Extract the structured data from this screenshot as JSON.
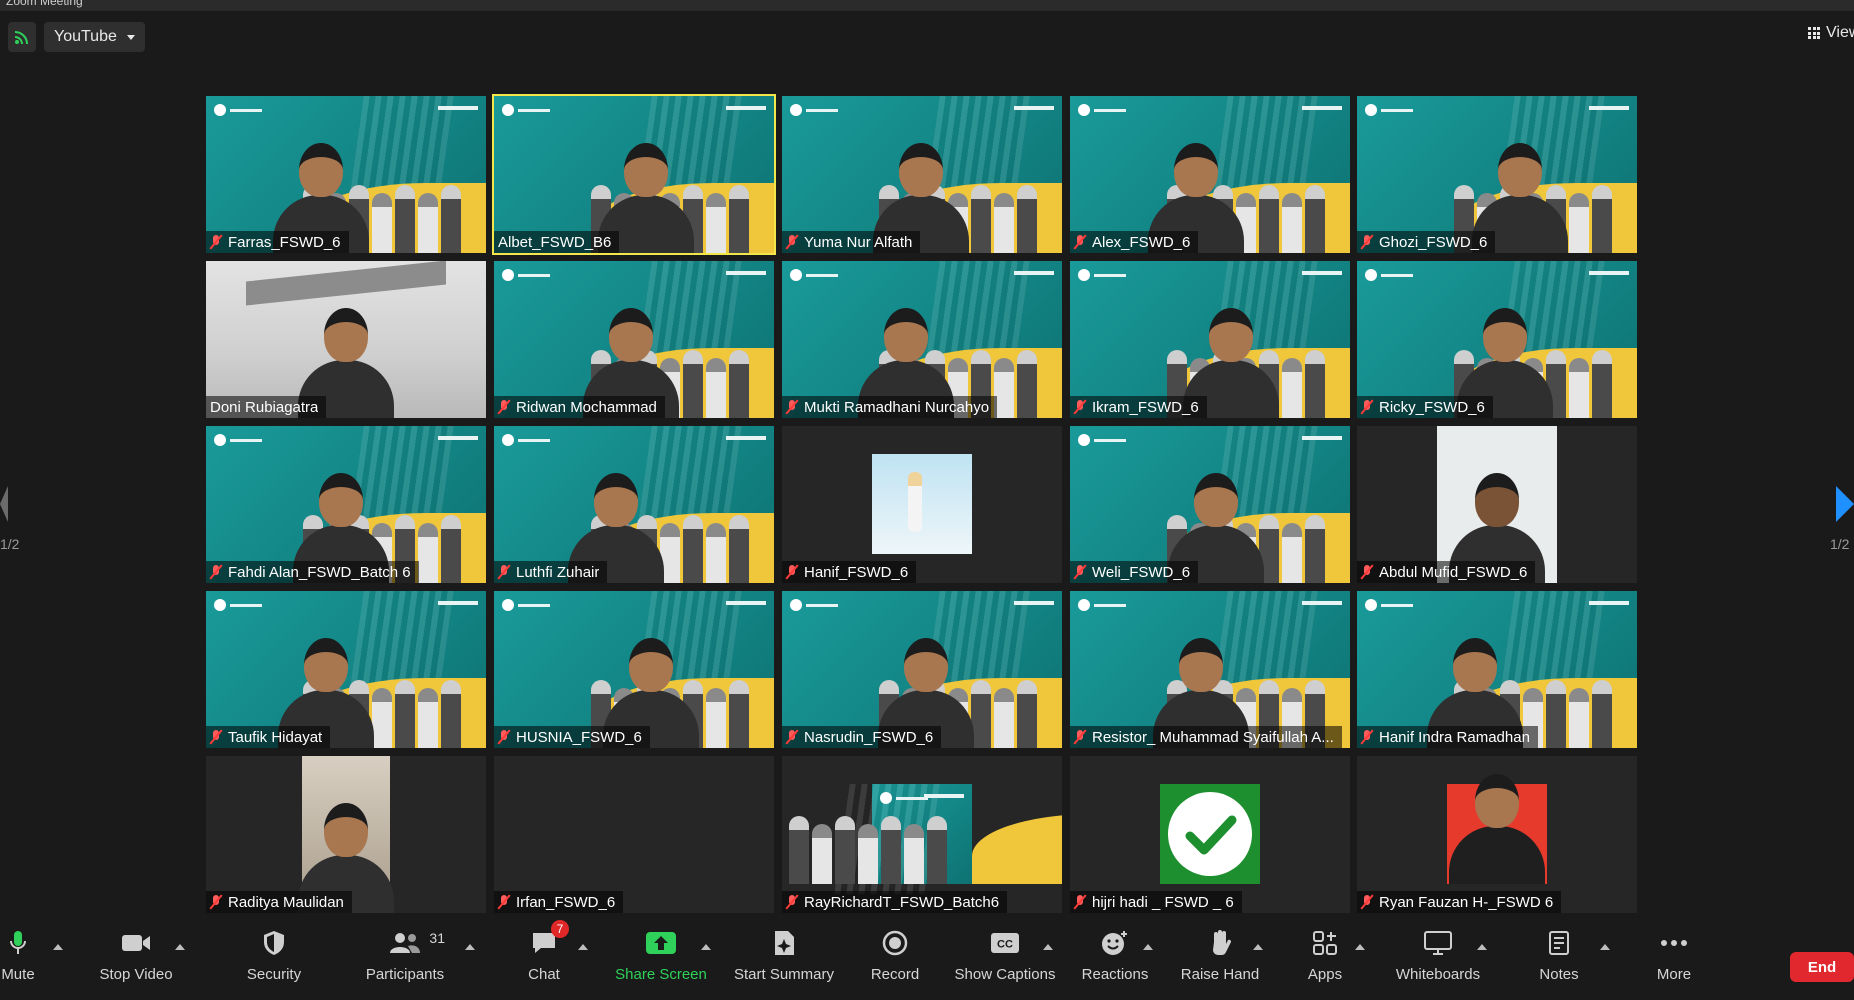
{
  "window": {
    "title": "Zoom Meeting"
  },
  "top_bar": {
    "source_select": "YouTube",
    "view_label": "View"
  },
  "pagination": {
    "left": "1/2",
    "right": "1/2"
  },
  "participants": [
    {
      "name": "Farras_FSWD_6",
      "muted": true
    },
    {
      "name": "Albet_FSWD_B6",
      "muted": false,
      "active_speaker": true
    },
    {
      "name": "Yuma Nur Alfath",
      "muted": true
    },
    {
      "name": "Alex_FSWD_6",
      "muted": true
    },
    {
      "name": "Ghozi_FSWD_6",
      "muted": true
    },
    {
      "name": "Doni Rubiagatra",
      "muted": false
    },
    {
      "name": "Ridwan Mochammad",
      "muted": true
    },
    {
      "name": "Mukti Ramadhani Nurcahyo",
      "muted": true
    },
    {
      "name": "Ikram_FSWD_6",
      "muted": true
    },
    {
      "name": "Ricky_FSWD_6",
      "muted": true
    },
    {
      "name": "Fahdi Alan_FSWD_Batch 6",
      "muted": true
    },
    {
      "name": "Luthfi Zuhair",
      "muted": true
    },
    {
      "name": "Hanif_FSWD_6",
      "muted": true
    },
    {
      "name": "Weli_FSWD_6",
      "muted": true
    },
    {
      "name": "Abdul Mufid_FSWD_6",
      "muted": true
    },
    {
      "name": "Taufik Hidayat",
      "muted": true
    },
    {
      "name": "HUSNIA_FSWD_6",
      "muted": true
    },
    {
      "name": "Nasrudin_FSWD_6",
      "muted": true
    },
    {
      "name": "Resistor_ Muhammad Syaifullah A...",
      "muted": true
    },
    {
      "name": "Hanif Indra Ramadhan",
      "muted": true
    },
    {
      "name": "Raditya Maulidan",
      "muted": true
    },
    {
      "name": "Irfan_FSWD_6",
      "muted": true
    },
    {
      "name": "RayRichardT_FSWD_Batch6",
      "muted": true
    },
    {
      "name": "hijri hadi _ FSWD _ 6",
      "muted": true
    },
    {
      "name": "Ryan Fauzan H-_FSWD 6",
      "muted": true
    }
  ],
  "toolbar": {
    "mute": "Mute",
    "stop_video": "Stop Video",
    "security": "Security",
    "participants": "Participants",
    "participants_count": "31",
    "chat": "Chat",
    "chat_badge": "7",
    "share_screen": "Share Screen",
    "start_summary": "Start Summary",
    "record": "Record",
    "show_captions": "Show Captions",
    "reactions": "Reactions",
    "raise_hand": "Raise Hand",
    "apps": "Apps",
    "whiteboards": "Whiteboards",
    "notes": "Notes",
    "more": "More",
    "end": "End"
  },
  "colors": {
    "active_speaker_border": "#f2e64a",
    "share_screen_green": "#2fd15a",
    "end_red": "#e0282e",
    "muted_icon": "#ff3b3b"
  }
}
